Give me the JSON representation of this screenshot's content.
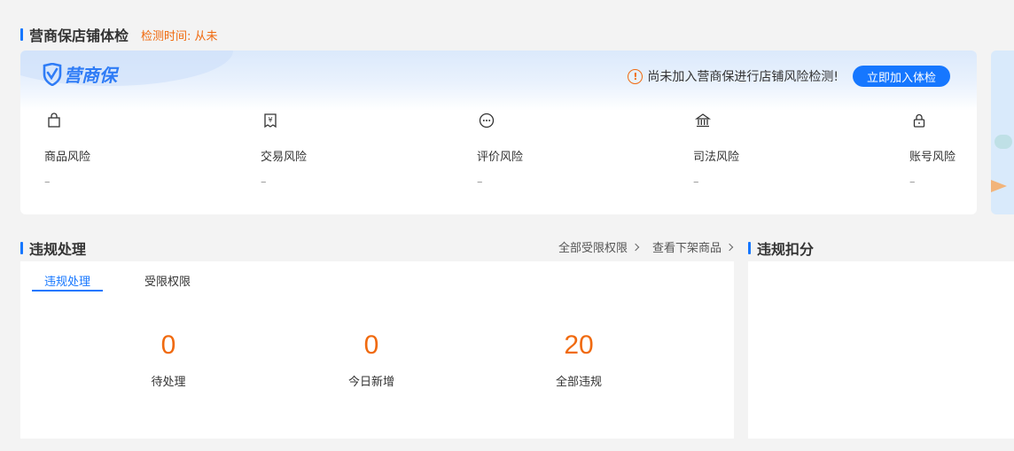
{
  "health": {
    "title": "营商保店铺体检",
    "check_time": "检测时间: 从未",
    "logo_text": "营商保",
    "notice": "尚未加入营商保进行店铺风险检测!",
    "join_button": "立即加入体检",
    "risks": [
      {
        "label": "商品风险",
        "value": "–",
        "icon": "shopping-bag-icon"
      },
      {
        "label": "交易风险",
        "value": "–",
        "icon": "yen-receipt-icon"
      },
      {
        "label": "评价风险",
        "value": "–",
        "icon": "chat-bubble-icon"
      },
      {
        "label": "司法风险",
        "value": "–",
        "icon": "courthouse-icon"
      },
      {
        "label": "账号风险",
        "value": "–",
        "icon": "lock-icon"
      }
    ]
  },
  "violation": {
    "title": "违规处理",
    "links": [
      "全部受限权限",
      "查看下架商品"
    ],
    "tabs": [
      "违规处理",
      "受限权限"
    ],
    "stats": [
      {
        "value": "0",
        "label": "待处理"
      },
      {
        "value": "0",
        "label": "今日新增"
      },
      {
        "value": "20",
        "label": "全部违规"
      }
    ]
  },
  "score": {
    "title": "违规扣分"
  },
  "colors": {
    "accent": "#1677ff",
    "warning": "#f06a0f",
    "background": "#f3f3f3"
  }
}
